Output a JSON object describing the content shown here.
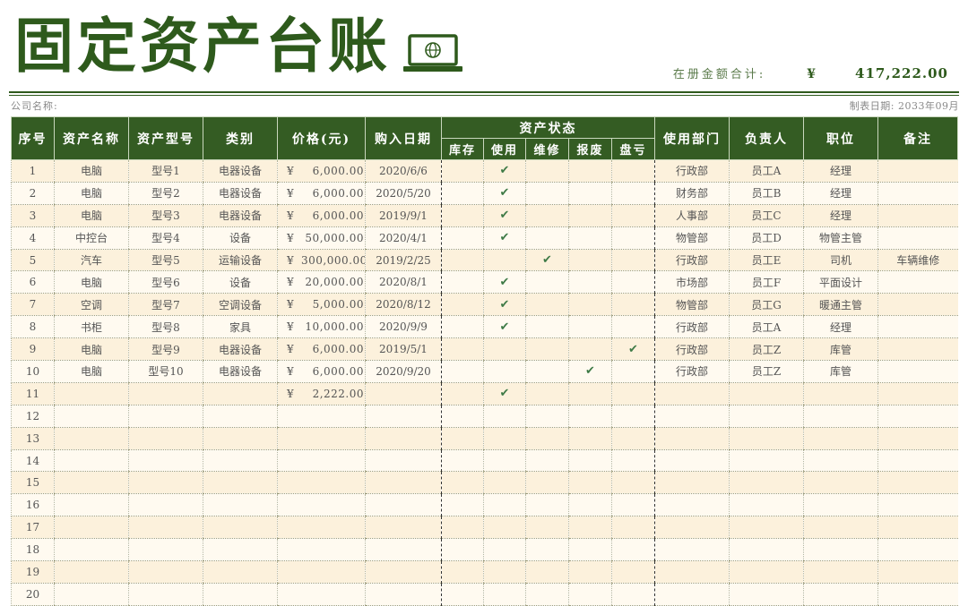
{
  "header": {
    "title": "固定资产台账",
    "total_label": "在册金额合计:",
    "total_currency": "¥",
    "total_amount": "417,222.00",
    "company_label": "公司名称:",
    "date_label": "制表日期: 2033年09月"
  },
  "columns": {
    "seq": "序号",
    "name": "资产名称",
    "model": "资产型号",
    "category": "类别",
    "price": "价格(元)",
    "purchase_date": "购入日期",
    "status_group": "资产状态",
    "status": [
      "库存",
      "使用",
      "维修",
      "报废",
      "盘亏"
    ],
    "dept": "使用部门",
    "owner": "负责人",
    "position": "职位",
    "note": "备注"
  },
  "check_glyph": "✔",
  "currency_symbol": "¥",
  "rows": [
    {
      "seq": "1",
      "name": "电脑",
      "model": "型号1",
      "category": "电器设备",
      "price": "6,000.00",
      "date": "2020/6/6",
      "status": 1,
      "dept": "行政部",
      "owner": "员工A",
      "position": "经理",
      "note": ""
    },
    {
      "seq": "2",
      "name": "电脑",
      "model": "型号2",
      "category": "电器设备",
      "price": "6,000.00",
      "date": "2020/5/20",
      "status": 1,
      "dept": "财务部",
      "owner": "员工B",
      "position": "经理",
      "note": ""
    },
    {
      "seq": "3",
      "name": "电脑",
      "model": "型号3",
      "category": "电器设备",
      "price": "6,000.00",
      "date": "2019/9/1",
      "status": 1,
      "dept": "人事部",
      "owner": "员工C",
      "position": "经理",
      "note": ""
    },
    {
      "seq": "4",
      "name": "中控台",
      "model": "型号4",
      "category": "设备",
      "price": "50,000.00",
      "date": "2020/4/1",
      "status": 1,
      "dept": "物管部",
      "owner": "员工D",
      "position": "物管主管",
      "note": ""
    },
    {
      "seq": "5",
      "name": "汽车",
      "model": "型号5",
      "category": "运输设备",
      "price": "300,000.00",
      "date": "2019/2/25",
      "status": 2,
      "dept": "行政部",
      "owner": "员工E",
      "position": "司机",
      "note": "车辆维修"
    },
    {
      "seq": "6",
      "name": "电脑",
      "model": "型号6",
      "category": "设备",
      "price": "20,000.00",
      "date": "2020/8/1",
      "status": 1,
      "dept": "市场部",
      "owner": "员工F",
      "position": "平面设计",
      "note": ""
    },
    {
      "seq": "7",
      "name": "空调",
      "model": "型号7",
      "category": "空调设备",
      "price": "5,000.00",
      "date": "2020/8/12",
      "status": 1,
      "dept": "物管部",
      "owner": "员工G",
      "position": "暖通主管",
      "note": ""
    },
    {
      "seq": "8",
      "name": "书柜",
      "model": "型号8",
      "category": "家具",
      "price": "10,000.00",
      "date": "2020/9/9",
      "status": 1,
      "dept": "行政部",
      "owner": "员工A",
      "position": "经理",
      "note": ""
    },
    {
      "seq": "9",
      "name": "电脑",
      "model": "型号9",
      "category": "电器设备",
      "price": "6,000.00",
      "date": "2019/5/1",
      "status": 4,
      "dept": "行政部",
      "owner": "员工Z",
      "position": "库管",
      "note": ""
    },
    {
      "seq": "10",
      "name": "电脑",
      "model": "型号10",
      "category": "电器设备",
      "price": "6,000.00",
      "date": "2020/9/20",
      "status": 3,
      "dept": "行政部",
      "owner": "员工Z",
      "position": "库管",
      "note": ""
    },
    {
      "seq": "11",
      "name": "",
      "model": "",
      "category": "",
      "price": "2,222.00",
      "date": "",
      "status": 1,
      "dept": "",
      "owner": "",
      "position": "",
      "note": ""
    },
    {
      "seq": "12",
      "name": "",
      "model": "",
      "category": "",
      "price": "",
      "date": "",
      "status": -1,
      "dept": "",
      "owner": "",
      "position": "",
      "note": ""
    },
    {
      "seq": "13",
      "name": "",
      "model": "",
      "category": "",
      "price": "",
      "date": "",
      "status": -1,
      "dept": "",
      "owner": "",
      "position": "",
      "note": ""
    },
    {
      "seq": "14",
      "name": "",
      "model": "",
      "category": "",
      "price": "",
      "date": "",
      "status": -1,
      "dept": "",
      "owner": "",
      "position": "",
      "note": ""
    },
    {
      "seq": "15",
      "name": "",
      "model": "",
      "category": "",
      "price": "",
      "date": "",
      "status": -1,
      "dept": "",
      "owner": "",
      "position": "",
      "note": ""
    },
    {
      "seq": "16",
      "name": "",
      "model": "",
      "category": "",
      "price": "",
      "date": "",
      "status": -1,
      "dept": "",
      "owner": "",
      "position": "",
      "note": ""
    },
    {
      "seq": "17",
      "name": "",
      "model": "",
      "category": "",
      "price": "",
      "date": "",
      "status": -1,
      "dept": "",
      "owner": "",
      "position": "",
      "note": ""
    },
    {
      "seq": "18",
      "name": "",
      "model": "",
      "category": "",
      "price": "",
      "date": "",
      "status": -1,
      "dept": "",
      "owner": "",
      "position": "",
      "note": ""
    },
    {
      "seq": "19",
      "name": "",
      "model": "",
      "category": "",
      "price": "",
      "date": "",
      "status": -1,
      "dept": "",
      "owner": "",
      "position": "",
      "note": ""
    },
    {
      "seq": "20",
      "name": "",
      "model": "",
      "category": "",
      "price": "",
      "date": "",
      "status": -1,
      "dept": "",
      "owner": "",
      "position": "",
      "note": ""
    }
  ]
}
